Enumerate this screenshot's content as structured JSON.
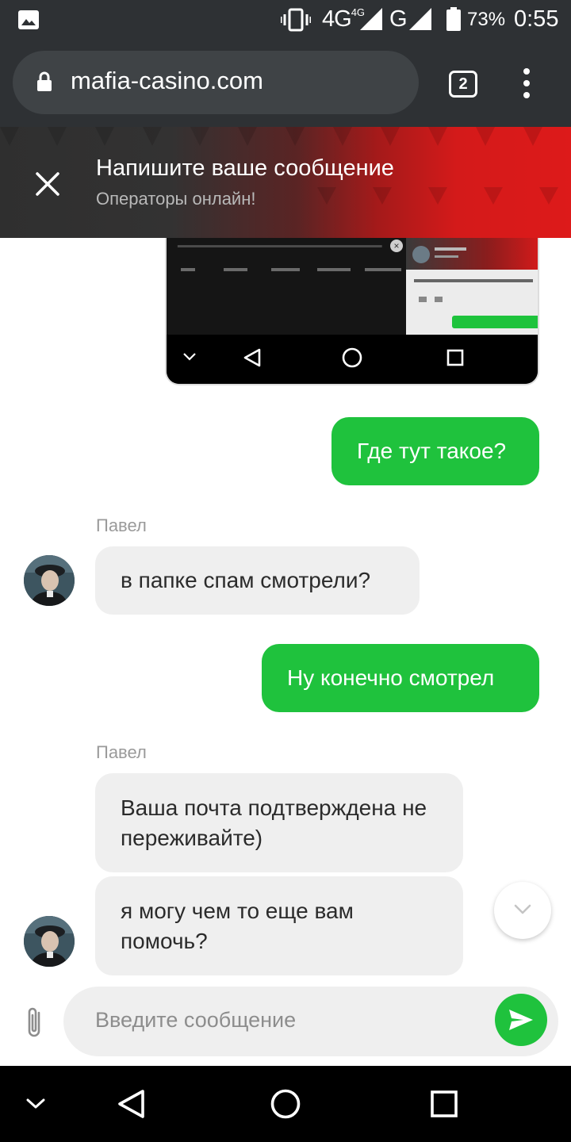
{
  "status_bar": {
    "network_4g": "4G",
    "network_4g_sup": "4G",
    "network_g": "G",
    "battery": "73%",
    "time": "0:55"
  },
  "browser": {
    "url": "mafia-casino.com",
    "tab_count": "2"
  },
  "chat_header": {
    "title": "Напишите ваше сообщение",
    "subtitle": "Операторы онлайн!"
  },
  "messages": [
    {
      "direction": "out",
      "text": "Где тут такое?"
    },
    {
      "direction": "in",
      "sender": "Павел",
      "text": "в папке спам смотрели?"
    },
    {
      "direction": "out",
      "text": "Ну конечно смотрел"
    },
    {
      "direction": "in",
      "sender": "Павел",
      "text": "Ваша почта подтверждена не переживайте)"
    },
    {
      "direction": "in",
      "text": "я могу чем то еще вам помочь?"
    }
  ],
  "composer": {
    "placeholder": "Введите сообщение"
  },
  "icons": {
    "close": "close-icon",
    "attach": "paperclip-icon",
    "send": "send-icon",
    "scroll_down": "chevron-down-icon"
  },
  "colors": {
    "accent_green": "#1fc23d",
    "header_red": "#dd1a1a",
    "browser_dark": "#2e3134"
  }
}
